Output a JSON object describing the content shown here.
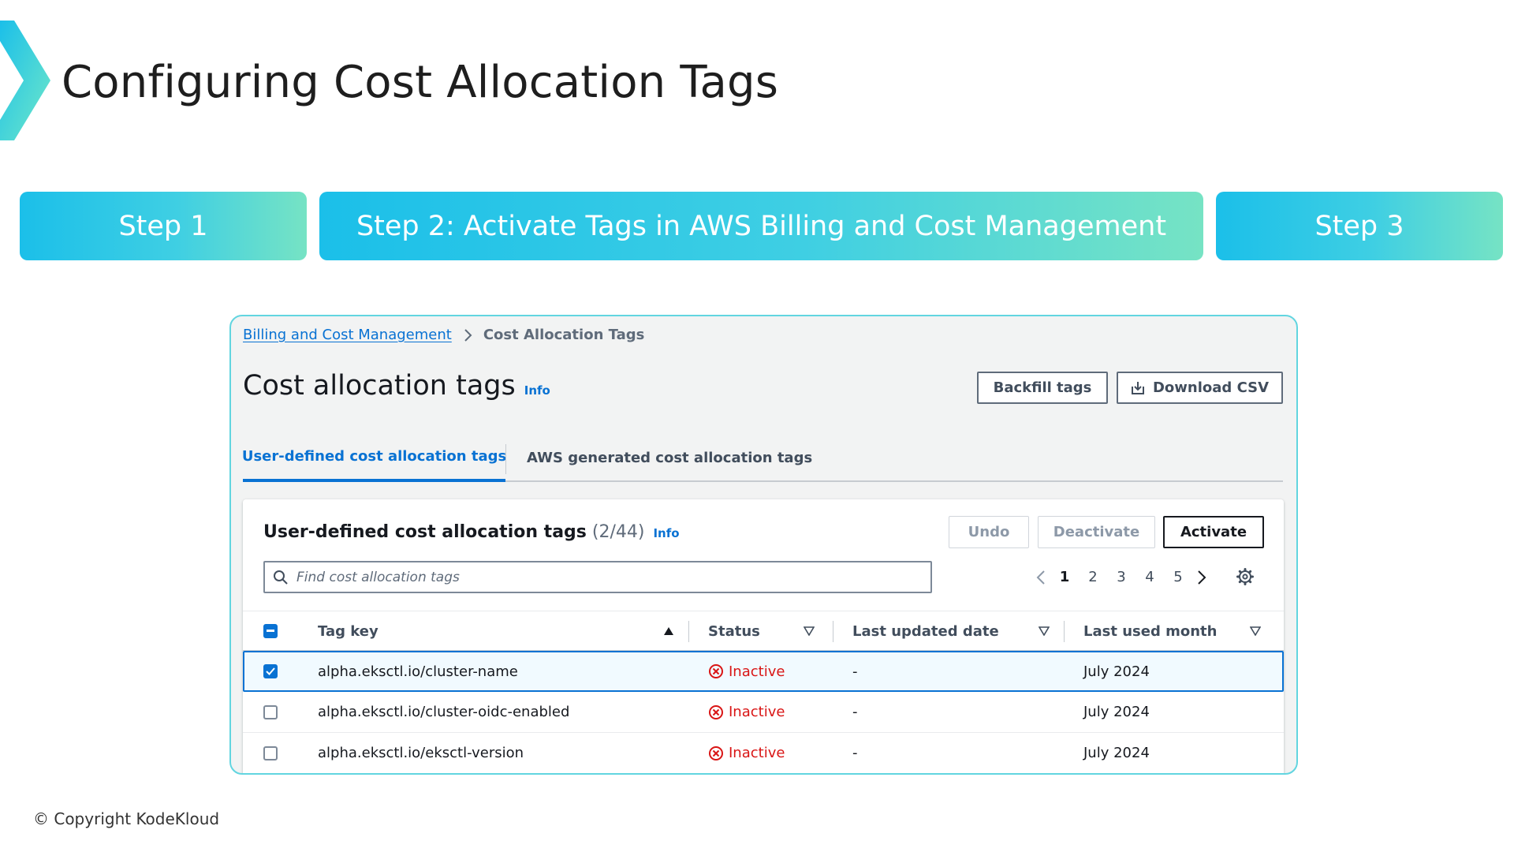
{
  "slide": {
    "title": "Configuring Cost Allocation Tags",
    "copyright": "© Copyright KodeKloud",
    "accent_gradient": [
      "#1bbfe9",
      "#76e3c4"
    ]
  },
  "steps": [
    {
      "label": "Step 1"
    },
    {
      "label": "Step 2: Activate Tags in AWS Billing and Cost Management"
    },
    {
      "label": "Step 3"
    }
  ],
  "console": {
    "breadcrumb": {
      "parent": "Billing and Cost Management",
      "current": "Cost Allocation Tags",
      "separator_icon": "chevron-right-icon"
    },
    "page_title": "Cost allocation tags",
    "info_label": "Info",
    "header_buttons": {
      "backfill": "Backfill tags",
      "download": "Download CSV",
      "download_icon": "download-icon"
    },
    "tabs": [
      {
        "label": "User-defined cost allocation tags",
        "active": true
      },
      {
        "label": "AWS generated cost allocation tags",
        "active": false
      }
    ],
    "table": {
      "title": "User-defined cost allocation tags",
      "count": "(2/44)",
      "info_label": "Info",
      "actions": {
        "undo": "Undo",
        "deactivate": "Deactivate",
        "activate": "Activate"
      },
      "search": {
        "value": "",
        "placeholder": "Find cost allocation tags",
        "icon": "search-icon"
      },
      "pagination": {
        "pages": [
          "1",
          "2",
          "3",
          "4",
          "5"
        ],
        "current": "1",
        "prev_icon": "chevron-left-icon",
        "next_icon": "chevron-right-icon",
        "settings_icon": "gear-icon"
      },
      "columns": [
        {
          "label": "Tag key",
          "sort": "ascending"
        },
        {
          "label": "Status",
          "sort": "none"
        },
        {
          "label": "Last updated date",
          "sort": "none"
        },
        {
          "label": "Last used month",
          "sort": "none"
        }
      ],
      "select_all_state": "mixed",
      "rows": [
        {
          "tag_key": "alpha.eksctl.io/cluster-name",
          "status": "Inactive",
          "last_updated": "-",
          "last_used": "July 2024",
          "selected": true
        },
        {
          "tag_key": "alpha.eksctl.io/cluster-oidc-enabled",
          "status": "Inactive",
          "last_updated": "-",
          "last_used": "July 2024",
          "selected": false
        },
        {
          "tag_key": "alpha.eksctl.io/eksctl-version",
          "status": "Inactive",
          "last_updated": "-",
          "last_used": "July 2024",
          "selected": false
        }
      ],
      "status_color": "#d91515",
      "link_color": "#0972d3"
    }
  }
}
